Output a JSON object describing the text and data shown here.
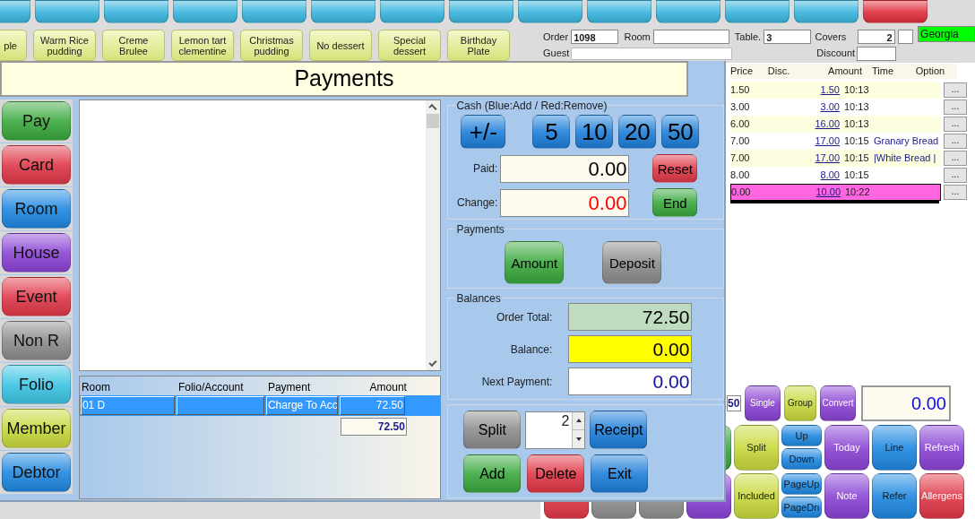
{
  "top_buttons": [
    {
      "color": "#3ab6de"
    },
    {
      "color": "#3ab6de"
    },
    {
      "color": "#3ab6de"
    },
    {
      "color": "#3ab6de"
    },
    {
      "color": "#3ab6de"
    },
    {
      "color": "#3ab6de"
    },
    {
      "color": "#3ab6de"
    },
    {
      "color": "#3ab6de"
    },
    {
      "color": "#3ab6de"
    },
    {
      "color": "#3ab6de"
    },
    {
      "color": "#3ab6de"
    },
    {
      "color": "#3ab6de"
    },
    {
      "color": "#3ab6de"
    },
    {
      "color": "#e0303c"
    }
  ],
  "dessert_buttons": [
    "ple",
    "Warm Rice pudding",
    "Creme Brulee",
    "Lemon tart clementine",
    "Christmas pudding",
    "No dessert",
    "Special dessert",
    "Birthday Plate"
  ],
  "order_header": {
    "order_label": "Order",
    "order": "1098",
    "room_label": "Room",
    "table_label": "Table.",
    "table": "3",
    "covers_label": "Covers",
    "covers": "2",
    "waiter": "Georgia",
    "guest_label": "Guest",
    "discount_label": "Discount"
  },
  "order_columns": [
    "Price",
    "Disc.",
    "Amount",
    "Time",
    "Option"
  ],
  "order_rows": [
    {
      "price": "1.50",
      "amount": "1.50",
      "time": "10:13",
      "option": "",
      "button": "...",
      "selected": false
    },
    {
      "price": "3.00",
      "amount": "3.00",
      "time": "10:13",
      "option": "",
      "button": "...",
      "selected": false
    },
    {
      "price": "6.00",
      "amount": "16.00",
      "time": "10:13",
      "option": "",
      "button": "...",
      "selected": false
    },
    {
      "price": "7.00",
      "amount": "17.00",
      "time": "10:15",
      "option": "Granary Bread",
      "button": "...",
      "selected": false
    },
    {
      "price": "7.00",
      "amount": "17.00",
      "time": "10:15",
      "option": "|White Bread |",
      "button": "...",
      "selected": false
    },
    {
      "price": "8.00",
      "amount": "8.00",
      "time": "10:15",
      "option": "",
      "button": "...",
      "selected": false
    },
    {
      "price": "0.00",
      "amount": "10.00",
      "time": "10:22",
      "option": "",
      "button": "...",
      "selected": true
    }
  ],
  "total_partial": "50",
  "small_buttons": [
    {
      "label": "Single",
      "color": "#8a44d4",
      "light_text": true
    },
    {
      "label": "Group",
      "color": "#c8d83c",
      "light_text": false
    },
    {
      "label": "Convert",
      "color": "#8a44d4",
      "light_text": true
    }
  ],
  "pay_field": "0.00",
  "order_buttons": [
    [
      {
        "color": "#3aa83e"
      },
      {
        "label": "Split",
        "color": "#c8d83c",
        "light_text": false
      },
      {
        "stack": [
          "Up",
          "Down"
        ],
        "color": "#1e88e0",
        "light_text": false
      },
      {
        "label": "Today",
        "color": "#8a44d4",
        "light_text": true
      },
      {
        "label": "Line",
        "color": "#1e88e0",
        "light_text": false
      },
      {
        "label": "Refresh",
        "color": "#8a44d4",
        "light_text": true
      }
    ],
    [
      {
        "color": "#e03848"
      },
      {
        "color": "#909090"
      },
      {
        "color": "#909090"
      },
      {
        "color": "#8a44d4"
      },
      {
        "label": "Included",
        "color": "#c8d83c",
        "light_text": false
      },
      {
        "stack": [
          "PageUp",
          "PageDn"
        ],
        "color": "#1e88e0",
        "light_text": false
      },
      {
        "label": "Note",
        "color": "#8a44d4",
        "light_text": true
      },
      {
        "label": "Refer",
        "color": "#1e88e0",
        "light_text": false
      },
      {
        "label": "Allergens",
        "color": "#e03848",
        "light_text": true
      }
    ]
  ],
  "dialog": {
    "title": "Payments",
    "methods": [
      {
        "label": "Pay",
        "color": "#3aa83e"
      },
      {
        "label": "Card",
        "color": "#e03848"
      },
      {
        "label": "Room",
        "color": "#1e88e0"
      },
      {
        "label": "House",
        "color": "#8a44d4"
      },
      {
        "label": "Event",
        "color": "#e03848"
      },
      {
        "label": "Non R",
        "color": "#8c8c8c"
      },
      {
        "label": "Folio",
        "color": "#3cc4e4"
      },
      {
        "label": "Member",
        "color": "#c8d83c"
      },
      {
        "label": "Debtor",
        "color": "#1e88e0"
      }
    ],
    "grid": {
      "columns": [
        "Room",
        "Folio/Account",
        "Payment",
        "Amount"
      ],
      "rows": [
        {
          "cells": [
            "01 D",
            "",
            "Charge To Acc",
            "72.50"
          ],
          "selected": true
        }
      ],
      "total": "72.50"
    },
    "cash": {
      "legend": "Cash (Blue:Add / Red:Remove)",
      "toggle": "+/-",
      "notes": [
        "5",
        "10",
        "20",
        "50"
      ],
      "paid_label": "Paid:",
      "paid": "0.00",
      "reset": "Reset",
      "change_label": "Change:",
      "change": "0.00",
      "end": "End"
    },
    "payments": {
      "legend": "Payments",
      "amount": "Amount",
      "deposit": "Deposit"
    },
    "balances": {
      "legend": "Balances",
      "order_total_label": "Order Total:",
      "order_total": "72.50",
      "balance_label": "Balance:",
      "balance": "0.00",
      "next_label": "Next Payment:",
      "next": "0.00"
    },
    "actions": {
      "split": "Split",
      "split_count": "2",
      "receipt": "Receipt",
      "add": "Add",
      "delete": "Delete",
      "exit": "Exit"
    }
  }
}
